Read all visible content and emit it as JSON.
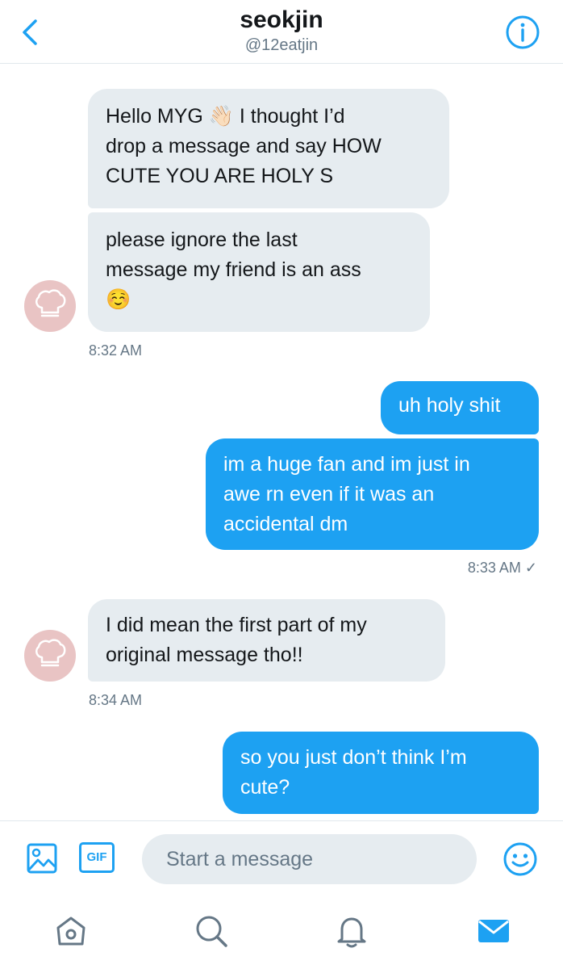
{
  "header": {
    "title": "seokjin",
    "handle": "@12eatjin"
  },
  "messages": [
    {
      "side": "in",
      "text": "Hello MYG 👋🏻 I thought I’d\ndrop a message and say HOW\nCUTE YOU ARE HOLY S"
    },
    {
      "side": "in",
      "text": "please ignore the last\nmessage my friend is an ass\n☺️"
    },
    {
      "side": "out",
      "text": "uh holy shit"
    },
    {
      "side": "out",
      "text": "im a huge fan and im just in\nawe rn even if it was an\naccidental dm"
    },
    {
      "side": "in",
      "text": "I did mean the first part of my\noriginal message tho!!"
    },
    {
      "side": "out",
      "text": "so you just don’t think I’m\ncute?"
    }
  ],
  "timestamps": {
    "t1": "8:32 AM",
    "t2": "8:33 AM ✓",
    "t3": "8:34 AM"
  },
  "composer": {
    "placeholder": "Start a message",
    "gif_label": "GIF"
  },
  "nav": {
    "items": [
      "home-icon",
      "search-icon",
      "notifications-icon",
      "messages-icon"
    ],
    "active": "messages-icon"
  },
  "colors": {
    "accent": "#1da1f2",
    "incoming_bubble": "#e6ecf0",
    "muted_text": "#657786",
    "avatar": "#e9c4c4"
  }
}
